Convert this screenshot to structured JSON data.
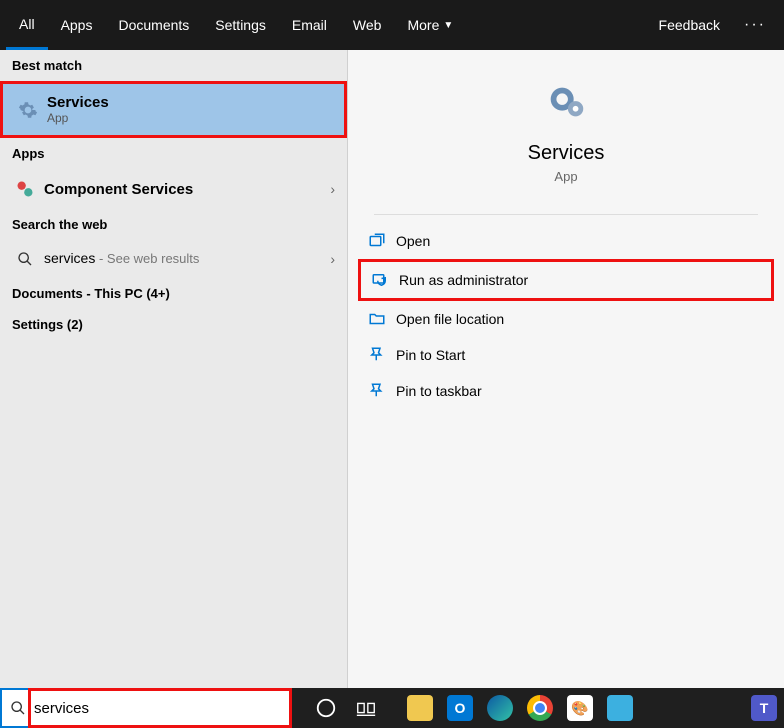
{
  "tabs": {
    "items": [
      "All",
      "Apps",
      "Documents",
      "Settings",
      "Email",
      "Web",
      "More"
    ],
    "active_index": 0,
    "feedback": "Feedback"
  },
  "left": {
    "best_match_label": "Best match",
    "best_match": {
      "title": "Services",
      "subtitle": "App"
    },
    "apps_label": "Apps",
    "apps_item": {
      "prefix": "Component ",
      "bold": "Services"
    },
    "search_web_label": "Search the web",
    "web_item": {
      "term": "services",
      "suffix": " - See web results"
    },
    "docs_label": "Documents - This PC (4+)",
    "settings_label": "Settings (2)"
  },
  "right": {
    "title": "Services",
    "subtitle": "App",
    "actions": {
      "open": "Open",
      "run_admin": "Run as administrator",
      "open_loc": "Open file location",
      "pin_start": "Pin to Start",
      "pin_taskbar": "Pin to taskbar"
    }
  },
  "search": {
    "value": "services"
  }
}
